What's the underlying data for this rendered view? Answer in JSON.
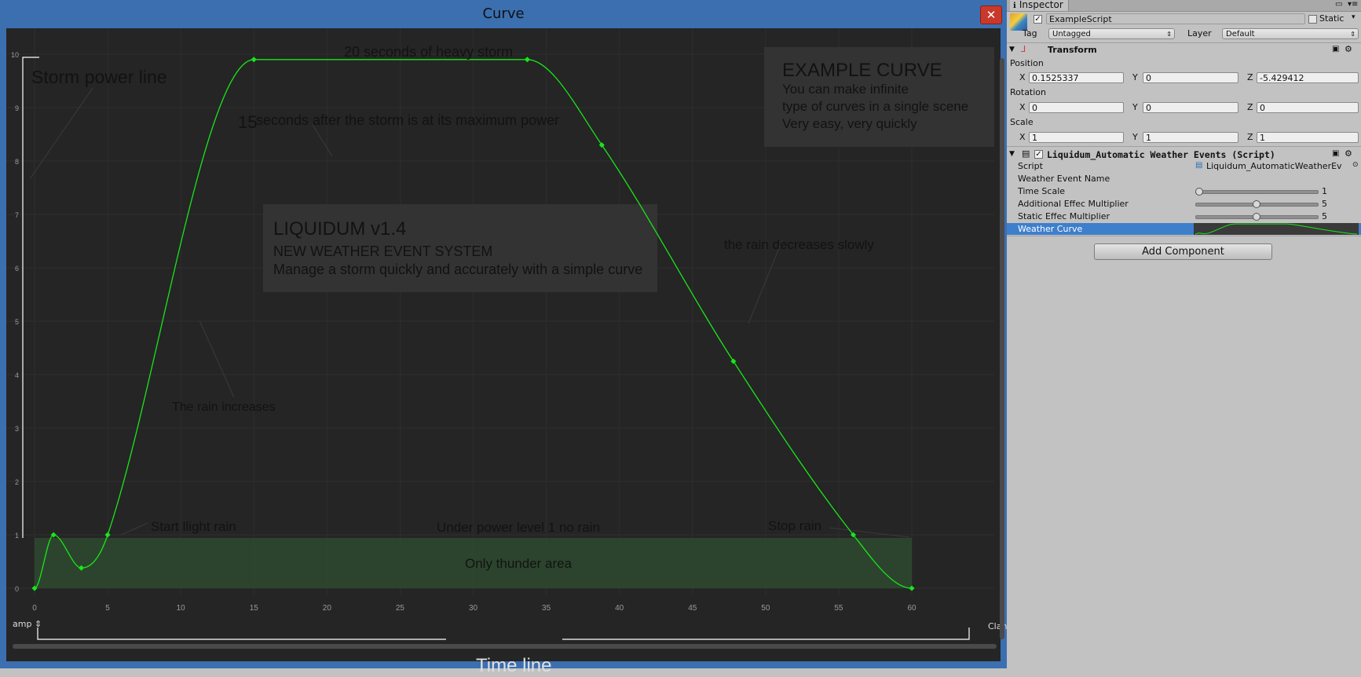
{
  "curve_window": {
    "title": "Curve",
    "close_icon": "close-icon",
    "wrap_left": "amp",
    "wrap_right": "Clan",
    "timeline_label": "Time line",
    "annotations": {
      "storm_power_line": "Storm power line",
      "heavy_storm": "20 seconds of heavy storm",
      "after_max_num": "15",
      "after_max": "seconds after the storm is at its maximum power",
      "rain_increases": "The rain increases",
      "rain_decreases": "the rain decreases slowly",
      "start_light_rain": "Start llight rain",
      "under_power": "Under power level 1 no rain",
      "stop_rain": "Stop rain",
      "thunder_area": "Only thunder area"
    },
    "example_box": {
      "title": "EXAMPLE CURVE",
      "line1": "You can make infinite",
      "line2": "type of curves in a single scene",
      "line3": "Very easy, very quickly"
    },
    "liquidum_box": {
      "title": "LIQUIDUM v1.4",
      "line1": "NEW WEATHER EVENT SYSTEM",
      "line2": "Manage a storm quickly and accurately with a simple curve"
    },
    "colors": {
      "curve": "#19e619",
      "thunder_area": "#2e4a30",
      "frame": "#3b6fb0",
      "background": "#252525"
    }
  },
  "chart_data": {
    "type": "line",
    "xlabel": "Time line",
    "ylabel": "Storm power line",
    "x_ticks": [
      0,
      5,
      10,
      15,
      20,
      25,
      30,
      35,
      40,
      45,
      50,
      55,
      60
    ],
    "y_ticks": [
      0,
      1,
      2,
      3,
      4,
      5,
      6,
      7,
      8,
      9,
      10
    ],
    "xlim": [
      0,
      60
    ],
    "ylim": [
      0,
      10
    ],
    "grid": true,
    "series": [
      {
        "keys": [
          {
            "x": 0,
            "y": 0
          },
          {
            "x": 1.3,
            "y": 1.0
          },
          {
            "x": 3.2,
            "y": 0.38
          },
          {
            "x": 5,
            "y": 1.0
          },
          {
            "x": 15,
            "y": 9.9
          },
          {
            "x": 33.7,
            "y": 9.9
          },
          {
            "x": 38.8,
            "y": 8.3
          },
          {
            "x": 47.8,
            "y": 4.25
          },
          {
            "x": 56,
            "y": 1.0
          },
          {
            "x": 60,
            "y": 0
          }
        ]
      }
    ]
  },
  "inspector": {
    "tab_label": "Inspector",
    "tab_icon": "info-icon",
    "lock_icon": "lock-icon",
    "menu_icon": "menu-icon",
    "object_name": "ExampleScript",
    "static_label": "Static",
    "tag_label": "Tag",
    "tag_value": "Untagged",
    "layer_label": "Layer",
    "layer_value": "Default",
    "transform": {
      "title": "Transform",
      "position_label": "Position",
      "rotation_label": "Rotation",
      "scale_label": "Scale",
      "x_label": "X",
      "y_label": "Y",
      "z_label": "Z",
      "position": [
        "0.1525337",
        "0",
        "-5.429412"
      ],
      "rotation": [
        "0",
        "0",
        "0"
      ],
      "scale": [
        "1",
        "1",
        "1"
      ]
    },
    "script_component": {
      "title": "Liquidum_Automatic Weather Events (Script)",
      "script_label": "Script",
      "script_value": "Liquidum_AutomaticWeatherEv",
      "event_name_label": "Weather Event Name",
      "time_scale_label": "Time Scale",
      "time_scale_value": "1",
      "time_scale_level": 0.0,
      "additional_label": "Additional Effec Multiplier",
      "additional_value": "5",
      "additional_level": 0.5,
      "static_effec_label": "Static Effec Multiplier",
      "static_effec_value": "5",
      "static_effec_level": 0.5,
      "weather_curve_label": "Weather Curve"
    },
    "add_component_label": "Add Component"
  }
}
